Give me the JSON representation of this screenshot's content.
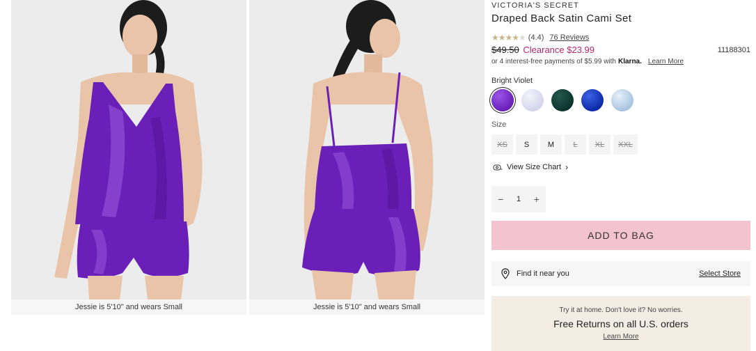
{
  "gallery": {
    "captions": [
      "Jessie is 5'10\" and wears Small",
      "Jessie is 5'10\" and wears Small"
    ]
  },
  "product": {
    "brand": "VICTORIA'S SECRET",
    "title": "Draped Back Satin Cami Set",
    "rating_value": "(4.4)",
    "rating_stars": 4.4,
    "reviews": "76 Reviews",
    "old_price": "$49.50",
    "sale_price": "Clearance $23.99",
    "sku": "11188301",
    "installments_text": "or 4 interest-free payments of $5.99 with",
    "installments_brand": "Klarna.",
    "learn_more": "Learn More"
  },
  "color": {
    "selected_name": "Bright Violet",
    "swatches": [
      {
        "name": "bright-violet",
        "color": "#7a2fd0"
      },
      {
        "name": "light-lavender",
        "color": "#dfe0ef"
      },
      {
        "name": "dark-green",
        "color": "#103f3a"
      },
      {
        "name": "royal-blue",
        "color": "#1437c7"
      },
      {
        "name": "sky-blue",
        "color": "#bcd3ea"
      }
    ]
  },
  "size": {
    "label": "Size",
    "options": [
      {
        "label": "XS",
        "available": false
      },
      {
        "label": "S",
        "available": true
      },
      {
        "label": "M",
        "available": true
      },
      {
        "label": "L",
        "available": false
      },
      {
        "label": "XL",
        "available": false
      },
      {
        "label": "XXL",
        "available": false
      }
    ],
    "chart_link": "View Size Chart"
  },
  "quantity": {
    "minus": "−",
    "value": "1",
    "plus": "+"
  },
  "cta": {
    "add_to_bag": "ADD TO BAG"
  },
  "store": {
    "text": "Find it near you",
    "link": "Select Store"
  },
  "returns": {
    "line1": "Try it at home. Don't love it? No worries.",
    "line2": "Free Returns on all U.S. orders",
    "link": "Learn More"
  },
  "colors": {
    "satin": "#6a1fb8",
    "satin_light": "#9b5be0",
    "skin": "#e9c4a8",
    "hair": "#1c1c1c",
    "cta_bg": "#f3c3cf",
    "sale": "#b0286f"
  }
}
